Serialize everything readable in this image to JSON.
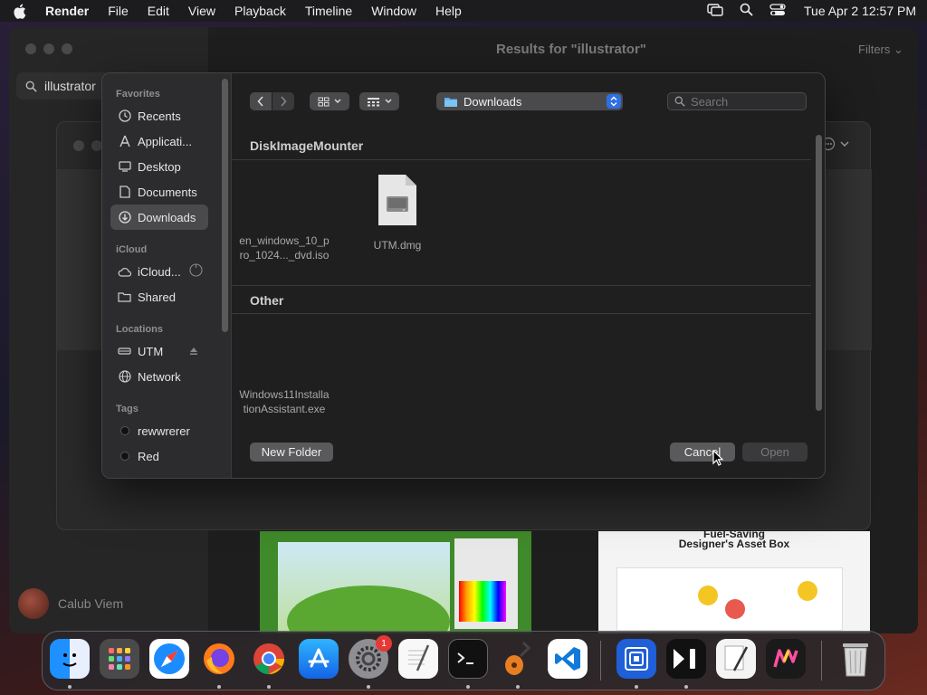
{
  "menubar": {
    "app": "Render",
    "items": [
      "File",
      "Edit",
      "View",
      "Playback",
      "Timeline",
      "Window",
      "Help"
    ],
    "clock": "Tue Apr 2  12:57 PM"
  },
  "background": {
    "search_value": "illustrator",
    "title": "Results for \"illustrator\"",
    "filters": "Filters",
    "user": "Calub Viem",
    "thumb2_title_1": "Fuel-Saving",
    "thumb2_title_2": "Designer's Asset Box"
  },
  "dialog": {
    "sidebar": {
      "favorites_label": "Favorites",
      "favorites": [
        "Recents",
        "Applicati...",
        "Desktop",
        "Documents",
        "Downloads"
      ],
      "icloud_label": "iCloud",
      "icloud": [
        "iCloud...",
        "Shared"
      ],
      "locations_label": "Locations",
      "locations": [
        "UTM",
        "Network"
      ],
      "tags_label": "Tags",
      "tags": [
        "rewwrerer",
        "Red"
      ]
    },
    "location": "Downloads",
    "search_placeholder": "Search",
    "groups": [
      {
        "title": "DiskImageMounter",
        "files": [
          {
            "name_line1": "en_windows_10_p",
            "name_line2": "ro_1024..._dvd.iso",
            "icon": "none"
          },
          {
            "name_line1": "UTM.dmg",
            "name_line2": "",
            "icon": "disk-image-icon"
          }
        ]
      },
      {
        "title": "Other",
        "files": [
          {
            "name_line1": "Windows11Installa",
            "name_line2": "tionAssistant.exe",
            "icon": "none"
          }
        ]
      }
    ],
    "buttons": {
      "new_folder": "New Folder",
      "cancel": "Cancel",
      "open": "Open"
    }
  },
  "dock": {
    "apps": [
      "finder-icon",
      "launchpad-icon",
      "safari-icon",
      "firefox-icon",
      "chrome-icon",
      "app-store-icon",
      "system-settings-icon",
      "textedit-icon",
      "terminal-icon",
      "garageband-icon",
      "vscode-icon",
      "utm-icon",
      "final-cut-icon",
      "script-editor-icon",
      "miro-icon",
      "trash-icon"
    ],
    "settings_badge": "1"
  }
}
